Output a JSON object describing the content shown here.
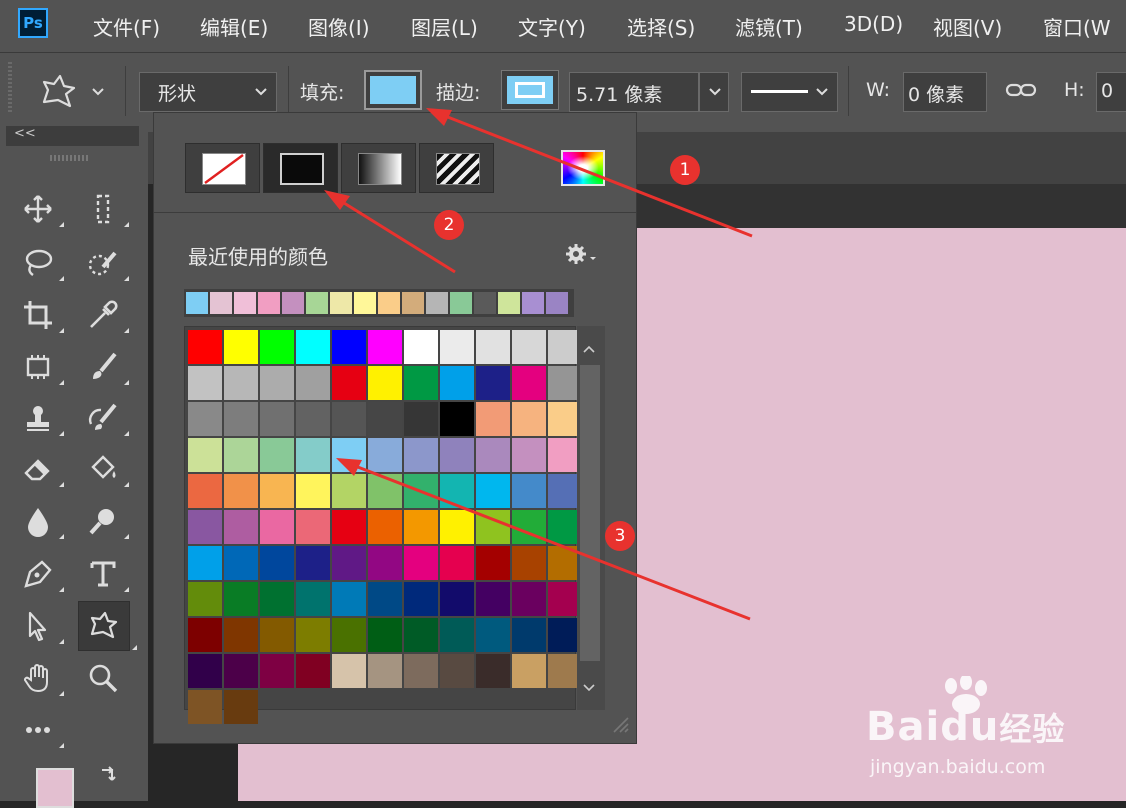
{
  "app": {
    "logo": "Ps"
  },
  "menu": [
    "文件(F)",
    "编辑(E)",
    "图像(I)",
    "图层(L)",
    "文字(Y)",
    "选择(S)",
    "滤镜(T)",
    "3D(D)",
    "视图(V)",
    "窗口(W"
  ],
  "options": {
    "mode_value": "形状",
    "fill_label": "填充:",
    "fill_color": "#7ecef4",
    "stroke_label": "描边:",
    "stroke_width": "5.71 像素",
    "w_label": "W:",
    "w_value": "0 像素",
    "h_label": "H:",
    "h_value": "0"
  },
  "popup": {
    "recent_title": "最近使用的颜色",
    "recent_colors": [
      "#7ecef4",
      "#e4c3d3",
      "#f0bfd8",
      "#f19ec2",
      "#c490bf",
      "#a7d696",
      "#eee8a8",
      "#fff799",
      "#facd89",
      "#d3ac7b",
      "#b5b5b5",
      "#89c997",
      "#5a5a5a",
      "#cfe59b",
      "#a88fd2",
      "#9a84c4"
    ],
    "swatches": [
      [
        "#ff0000",
        "#ffff00",
        "#00ff00",
        "#00ffff",
        "#0000ff",
        "#ff00ff",
        "#ffffff",
        "#ebebeb",
        "#e1e1e1",
        "#d7d7d7",
        "#cccccc"
      ],
      [
        "#c2c2c2",
        "#b7b7b7",
        "#acacac",
        "#a0a0a0",
        "#e60012",
        "#fff100",
        "#009944",
        "#00a0e9",
        "#1d2088",
        "#e4007f",
        "#959595"
      ],
      [
        "#898989",
        "#7d7d7d",
        "#707070",
        "#626262",
        "#555555",
        "#464646",
        "#363636",
        "#000000",
        "#f29b76",
        "#f6b37f",
        "#facd89"
      ],
      [
        "#cce198",
        "#acd598",
        "#89c997",
        "#84ccc9",
        "#7ecef4",
        "#88abda",
        "#8c97cb",
        "#8f82bc",
        "#aa89bd",
        "#c490bf",
        "#f19ec2"
      ],
      [
        "#eb6841",
        "#f19149",
        "#f8b551",
        "#fff45c",
        "#b3d465",
        "#80c269",
        "#32b16c",
        "#13b5b1",
        "#00b7ee",
        "#448aca",
        "#556fb5"
      ],
      [
        "#8957a1",
        "#ae5da1",
        "#ea68a2",
        "#eb6877",
        "#e60012",
        "#eb6100",
        "#f39800",
        "#fff100",
        "#8fc31f",
        "#22ac38",
        "#009944"
      ],
      [
        "#00a0e9",
        "#0068b7",
        "#00479d",
        "#1d2088",
        "#601986",
        "#920783",
        "#e4007f",
        "#e5004f",
        "#a40000",
        "#a84200",
        "#b36d00"
      ],
      [
        "#638c0b",
        "#097c25",
        "#007130",
        "#00736d",
        "#007ab7",
        "#004986",
        "#00297b",
        "#120b6b",
        "#440062",
        "#6a005f",
        "#a4004f"
      ],
      [
        "#7d0000",
        "#7f3600",
        "#835a00",
        "#7d7d00",
        "#4a7100",
        "#005e15",
        "#005b26",
        "#005b57",
        "#005a7e",
        "#003a6c",
        "#001c58"
      ],
      [
        "#31004a",
        "#4c0049",
        "#7e0043",
        "#800022",
        "#d6c3aa",
        "#a59481",
        "#7d6b5d",
        "#584a41",
        "#3a2c2a",
        "#c9a063",
        "#9e7a4d"
      ],
      [
        "#7e5425",
        "#683b0f"
      ]
    ],
    "fill_types": [
      "no-fill",
      "solid-color",
      "gradient",
      "pattern"
    ]
  },
  "annotations": [
    "1",
    "2",
    "3"
  ],
  "watermark": {
    "brand": "Baidu",
    "brand_cn": "经验",
    "url": "jingyan.baidu.com"
  },
  "colors": {
    "menu_bg": "#535353",
    "canvas": "#e3bfd0",
    "annotation": "#e8322e"
  }
}
